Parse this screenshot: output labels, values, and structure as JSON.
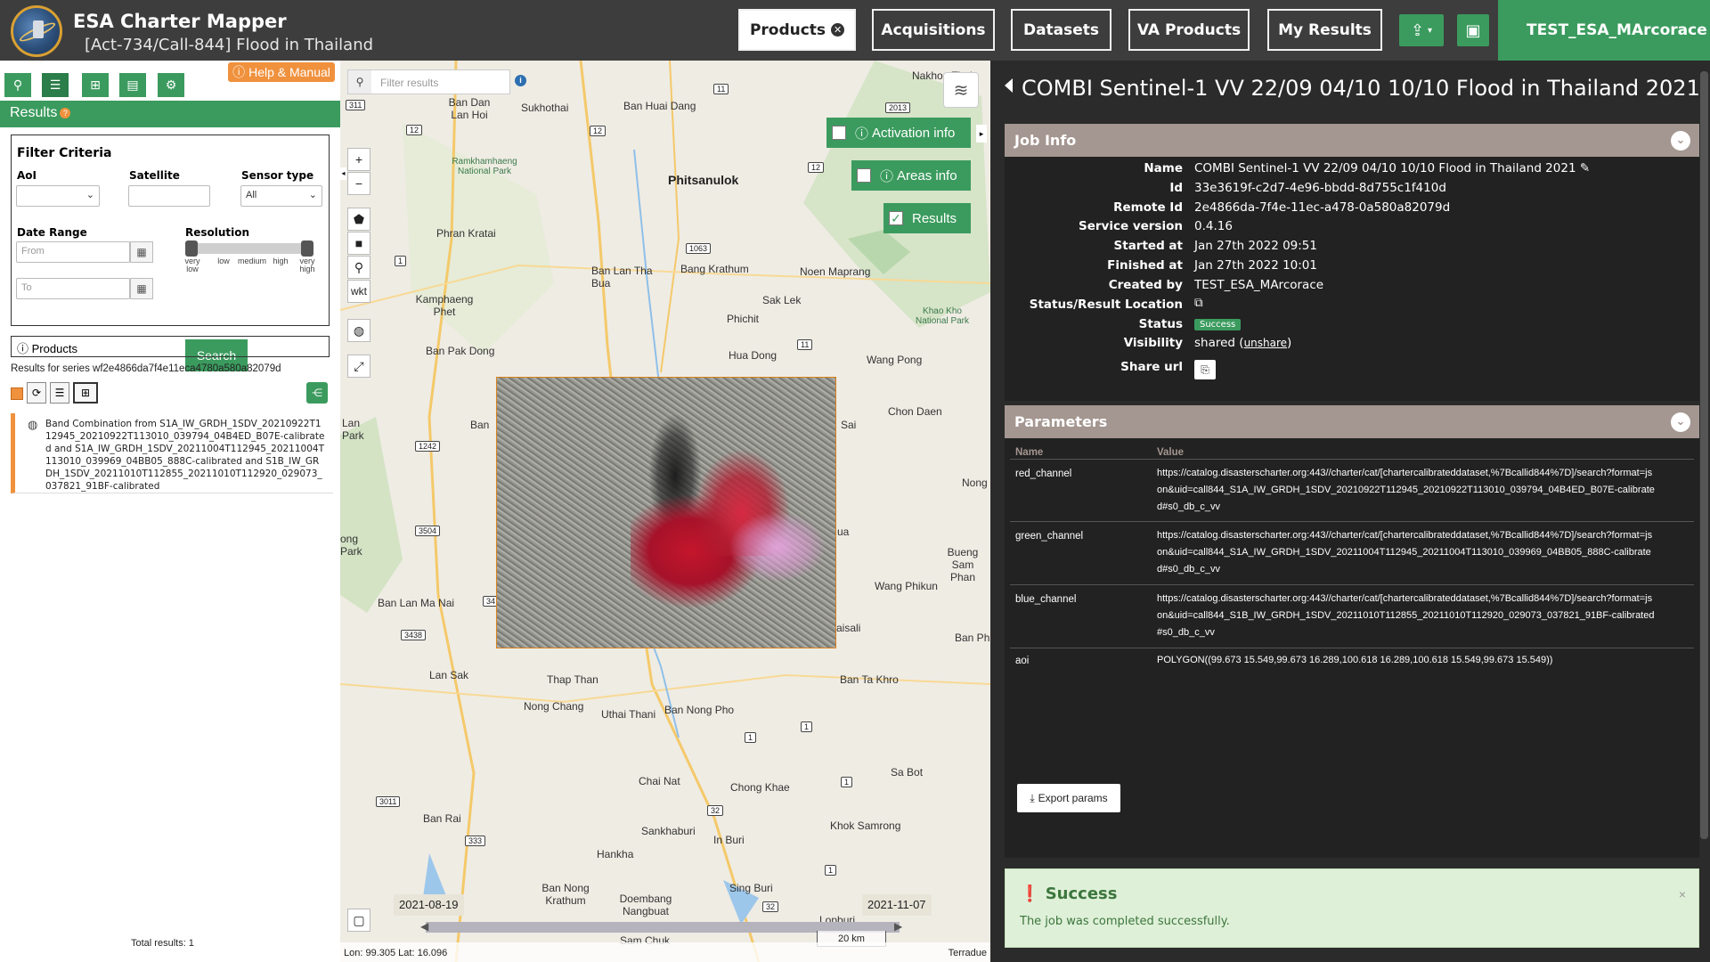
{
  "app": {
    "title": "ESA Charter Mapper",
    "subtitle": "[Act-734/Call-844] Flood in Thailand"
  },
  "nav": {
    "products": "Products",
    "acquisitions": "Acquisitions",
    "datasets": "Datasets",
    "va_products": "VA Products",
    "my_results": "My Results",
    "user": "TEST_ESA_MArcorace",
    "upload_icon": "upload-icon",
    "briefcase_icon": "briefcase-icon"
  },
  "left": {
    "help": "Help & Manual",
    "results_title": "Results",
    "filter_title": "Filter Criteria",
    "aoi_label": "AoI",
    "satellite_label": "Satellite",
    "sensor_label": "Sensor type",
    "sensor_value": "All",
    "date_range_label": "Date Range",
    "from_placeholder": "From",
    "to_placeholder": "To",
    "resolution_label": "Resolution",
    "res_ticks": [
      "very low",
      "low",
      "medium",
      "high",
      "very high"
    ],
    "search": "Search",
    "products_header": "Products",
    "series_text": "Results for series wf2e4866da7f4e11eca4780a580a82079d",
    "result_title": "Band Combination from S1A_IW_GRDH_1SDV_20210922T112945_20210922T113010_039794_04B4ED_B07E-calibrated and S1A_IW_GRDH_1SDV_20211004T112945_20211004T113010_039969_04BB05_888C-calibrated and S1B_IW_GRDH_1SDV_20211010T112855_20211010T112920_029073_037821_91BF-calibrated",
    "total": "Total results: 1"
  },
  "map": {
    "filter_placeholder": "Filter results",
    "zoom_in": "+",
    "zoom_out": "−",
    "wkt": "wkt",
    "activation_info": "Activation info",
    "areas_info": "Areas info",
    "results_toggle": "Results",
    "date_start": "2021-08-19",
    "date_end": "2021-11-07",
    "scale": "20 km",
    "coords": "Lon: 99.305 Lat: 16.096",
    "attribution": "Terradue",
    "places": [
      {
        "name": "Nakhon Thai",
        "big": false
      },
      {
        "name": "Ban Dan Lan Hoi",
        "big": false
      },
      {
        "name": "Sukhothai",
        "big": false
      },
      {
        "name": "Ban Huai Dang",
        "big": false
      },
      {
        "name": "Phitsanulok",
        "big": true
      },
      {
        "name": "Phran Kratai",
        "big": false
      },
      {
        "name": "Ban Lan Tha Bua",
        "big": false
      },
      {
        "name": "Bang Krathum",
        "big": false
      },
      {
        "name": "Noen Maprang",
        "big": false
      },
      {
        "name": "Kamphaeng Phet",
        "big": false
      },
      {
        "name": "Sak Lek",
        "big": false
      },
      {
        "name": "Phichit",
        "big": false
      },
      {
        "name": "Ban Pak Dong",
        "big": false
      },
      {
        "name": "Hua Dong",
        "big": false
      },
      {
        "name": "Wang Pong",
        "big": false
      },
      {
        "name": "Chon Daen",
        "big": false
      },
      {
        "name": "Ban Lan Ma Nai",
        "big": false
      },
      {
        "name": "Wang Phikun",
        "big": false
      },
      {
        "name": "Bueng Sam Phan",
        "big": false
      },
      {
        "name": "Lan Sak",
        "big": false
      },
      {
        "name": "Thap Than",
        "big": false
      },
      {
        "name": "Nong Chang",
        "big": false
      },
      {
        "name": "Uthai Thani",
        "big": false
      },
      {
        "name": "Ban Nong Pho",
        "big": false
      },
      {
        "name": "Ban Ta Khro",
        "big": false
      },
      {
        "name": "Chai Nat",
        "big": false
      },
      {
        "name": "Chong Khae",
        "big": false
      },
      {
        "name": "Sa Bot",
        "big": false
      },
      {
        "name": "Ban Rai",
        "big": false
      },
      {
        "name": "Sankhaburi",
        "big": false
      },
      {
        "name": "In Buri",
        "big": false
      },
      {
        "name": "Khok Samrong",
        "big": false
      },
      {
        "name": "Hankha",
        "big": false
      },
      {
        "name": "Ban Nong Krathum",
        "big": false
      },
      {
        "name": "Doembang Nangbuat",
        "big": false
      },
      {
        "name": "Sing Buri",
        "big": false
      },
      {
        "name": "Lopburi",
        "big": false
      },
      {
        "name": "Sam Chuk",
        "big": false
      },
      {
        "name": "Ban Ph",
        "big": false
      },
      {
        "name": "Nong",
        "big": false
      },
      {
        "name": "Ban",
        "big": false
      },
      {
        "name": "Sai",
        "big": false
      },
      {
        "name": "aisali",
        "big": false
      },
      {
        "name": "ua",
        "big": false
      },
      {
        "name": "Lan Park",
        "big": false
      },
      {
        "name": "ong Park",
        "big": false
      }
    ],
    "parks": [
      "Ramkhamhaeng National Park",
      "Khao Kho National Park"
    ],
    "routes": [
      "311",
      "12",
      "12",
      "11",
      "12",
      "2013",
      "1",
      "1063",
      "11",
      "1242",
      "3504",
      "3438",
      "34",
      "1",
      "1",
      "3011",
      "333",
      "32",
      "1",
      "32",
      "1"
    ]
  },
  "job": {
    "title": "COMBI Sentinel-1 VV 22/09 04/10 10/10 Flood in Thailand 2021",
    "job_info_header": "Job Info",
    "labels": {
      "name": "Name",
      "id": "Id",
      "remote_id": "Remote Id",
      "service_version": "Service version",
      "started": "Started at",
      "finished": "Finished at",
      "created_by": "Created by",
      "location": "Status/Result Location",
      "status": "Status",
      "visibility": "Visibility",
      "share": "Share url"
    },
    "values": {
      "name": "COMBI Sentinel-1 VV 22/09 04/10 10/10 Flood in Thailand 2021",
      "id": "33e3619f-c2d7-4e96-bbdd-8d755c1f410d",
      "remote_id": "2e4866da-7f4e-11ec-a478-0a580a82079d",
      "service_version": "0.4.16",
      "started": "Jan 27th 2022 09:51",
      "finished": "Jan 27th 2022 10:01",
      "created_by": "TEST_ESA_MArcorace",
      "status": "Success",
      "visibility": "shared",
      "unshare": "unshare"
    },
    "params_header": "Parameters",
    "col_name": "Name",
    "col_value": "Value",
    "params": [
      {
        "name": "red_channel",
        "value": "https://catalog.disasterscharter.org:443//charter/cat/[chartercalibrateddataset,%7Bcallid844%7D]/search?format=json&uid=call844_S1A_IW_GRDH_1SDV_20210922T112945_20210922T113010_039794_04B4ED_B07E-calibrated#s0_db_c_vv"
      },
      {
        "name": "green_channel",
        "value": "https://catalog.disasterscharter.org:443//charter/cat/[chartercalibrateddataset,%7Bcallid844%7D]/search?format=json&uid=call844_S1A_IW_GRDH_1SDV_20211004T112945_20211004T113010_039969_04BB05_888C-calibrated#s0_db_c_vv"
      },
      {
        "name": "blue_channel",
        "value": "https://catalog.disasterscharter.org:443//charter/cat/[chartercalibrateddataset,%7Bcallid844%7D]/search?format=json&uid=call844_S1B_IW_GRDH_1SDV_20211010T112855_20211010T112920_029073_037821_91BF-calibrated#s0_db_c_vv"
      },
      {
        "name": "aoi",
        "value": "POLYGON((99.673 15.549,99.673 16.289,100.618 16.289,100.618 15.549,99.673 15.549))"
      }
    ],
    "export": "Export params",
    "success_title": "Success",
    "success_msg": "The job was completed successfully."
  }
}
